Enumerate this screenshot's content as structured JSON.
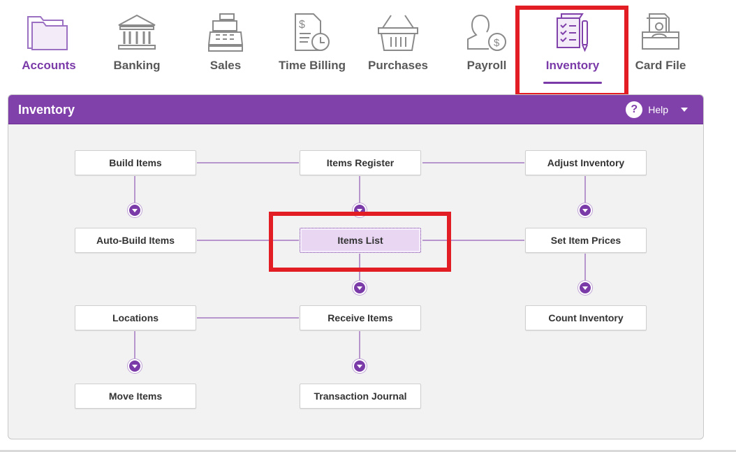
{
  "nav": {
    "items": [
      {
        "label": "Accounts",
        "icon": "folder-icon"
      },
      {
        "label": "Banking",
        "icon": "bank-icon"
      },
      {
        "label": "Sales",
        "icon": "cash-register-icon"
      },
      {
        "label": "Time Billing",
        "icon": "time-billing-icon"
      },
      {
        "label": "Purchases",
        "icon": "basket-icon"
      },
      {
        "label": "Payroll",
        "icon": "payroll-icon"
      },
      {
        "label": "Inventory",
        "icon": "clipboard-pen-icon"
      },
      {
        "label": "Card File",
        "icon": "card-file-icon"
      }
    ],
    "active": "Inventory"
  },
  "panel": {
    "title": "Inventory",
    "help_label": "Help"
  },
  "flow": {
    "build_items": "Build Items",
    "items_register": "Items Register",
    "adjust_inventory": "Adjust Inventory",
    "auto_build_items": "Auto-Build Items",
    "items_list": "Items List",
    "set_item_prices": "Set Item Prices",
    "locations": "Locations",
    "receive_items": "Receive Items",
    "count_inventory": "Count Inventory",
    "move_items": "Move Items",
    "transaction_journal": "Transaction Journal"
  },
  "colors": {
    "brand_purple": "#8041ab",
    "highlight_red": "#e21d24",
    "selected_fill": "#e8d6f3"
  }
}
